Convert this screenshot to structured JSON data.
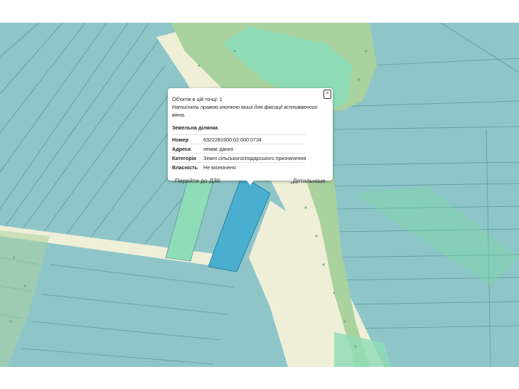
{
  "popup": {
    "objects_count_text": "Об'єктів в цій точці: 1",
    "hint_text": "Натисніть правою кнопкою миші для фіксації вспливаючого вікна.",
    "close_label": "×",
    "section_title": "Земельна ділянка",
    "rows": [
      {
        "key": "Номер",
        "value": "6322281500:02:000:0734"
      },
      {
        "key": "Адреса",
        "value": "немає даних"
      },
      {
        "key": "Категорія",
        "value": "Землі сільськогосподарського призначення"
      },
      {
        "key": "Власність",
        "value": "Не визначено"
      }
    ],
    "goto_dzk_label": "Перейти до ДЗК",
    "details_label": "Детальніше"
  },
  "map": {
    "colors": {
      "parcel": "#8ec5c9",
      "parcel_line": "#5a9aa0",
      "road": "#efefd8",
      "field_green": "#a9d29e",
      "light_green_parcel": "#8fdcb6",
      "selected_parcel": "#4aaed0",
      "overlay_green": "#7fd9a6"
    }
  }
}
